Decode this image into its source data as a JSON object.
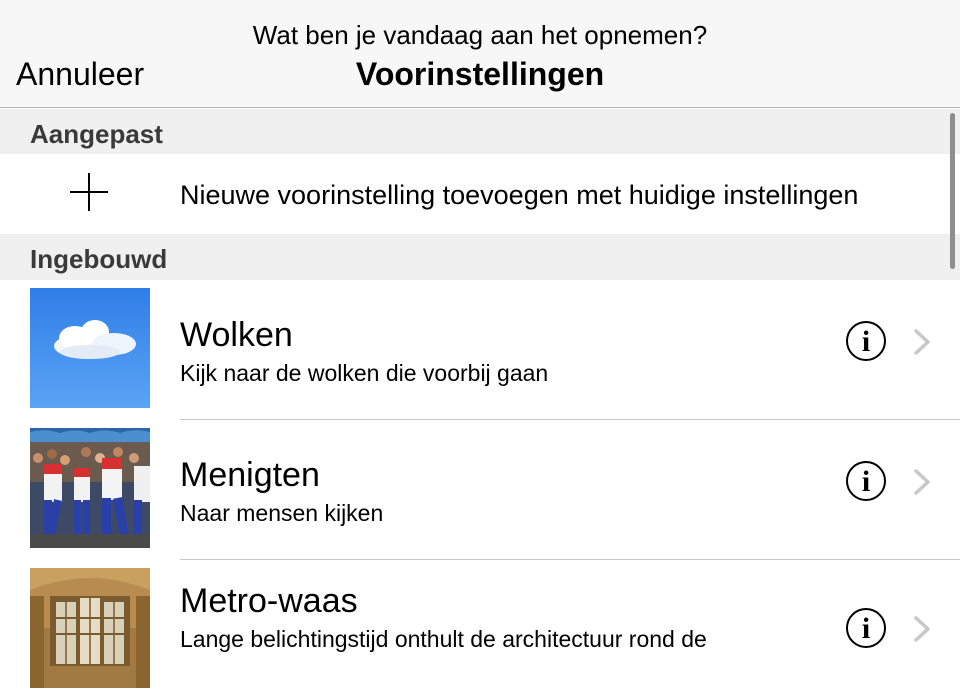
{
  "navbar": {
    "prompt": "Wat ben je vandaag aan het opnemen?",
    "title": "Voorinstellingen",
    "cancel_label": "Annuleer"
  },
  "sections": {
    "custom": {
      "header": "Aangepast",
      "add_label": "Nieuwe voorinstelling toevoegen met huidige instellingen"
    },
    "builtin": {
      "header": "Ingebouwd",
      "items": [
        {
          "title": "Wolken",
          "subtitle": "Kijk naar de wolken die voorbij gaan",
          "thumbnail": "clouds-thumbnail"
        },
        {
          "title": "Menigten",
          "subtitle": "Naar mensen kijken",
          "thumbnail": "crowd-thumbnail"
        },
        {
          "title": "Metro-waas",
          "subtitle": "Lange belichtingstijd onthult de architectuur rond de",
          "thumbnail": "station-thumbnail"
        }
      ]
    }
  },
  "icons": {
    "info": "i",
    "add": "plus-icon",
    "disclosure": "chevron-right-icon"
  },
  "colors": {
    "navbar_bg": "#f7f7f7",
    "section_bg": "#f0f0f0",
    "chevron": "#c7c7cc"
  }
}
